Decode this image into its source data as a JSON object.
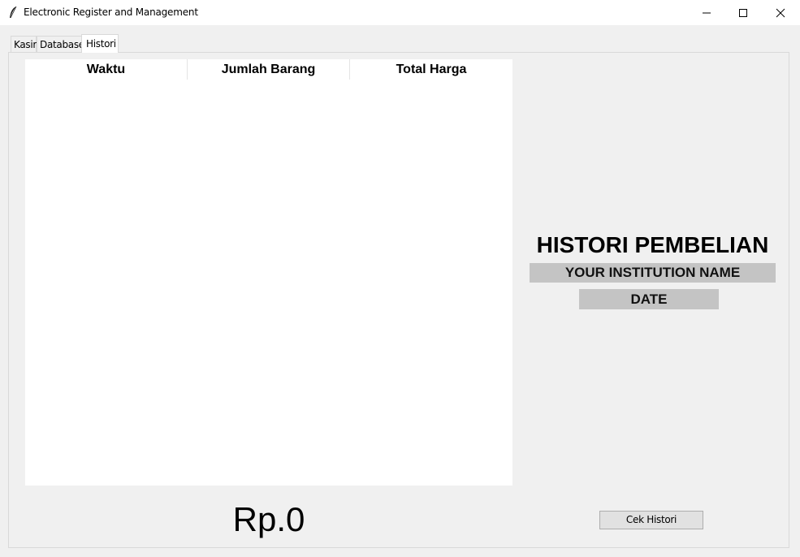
{
  "window": {
    "title": "Electronic Register and Management",
    "icon": "feather-icon"
  },
  "tabs": [
    {
      "label": "Kasir",
      "selected": false
    },
    {
      "label": "Database",
      "selected": false
    },
    {
      "label": "Histori",
      "selected": true
    }
  ],
  "table": {
    "columns": [
      "Waktu",
      "Jumlah Barang",
      "Total Harga"
    ],
    "rows": []
  },
  "info": {
    "title": "HISTORI PEMBELIAN",
    "institution": "YOUR INSTITUTION NAME",
    "date": "DATE"
  },
  "total_label": "Rp.0",
  "button_label": "Cek Histori",
  "colors": {
    "label_bg": "#c4c4c4",
    "window_bg": "#f0f0f0"
  }
}
